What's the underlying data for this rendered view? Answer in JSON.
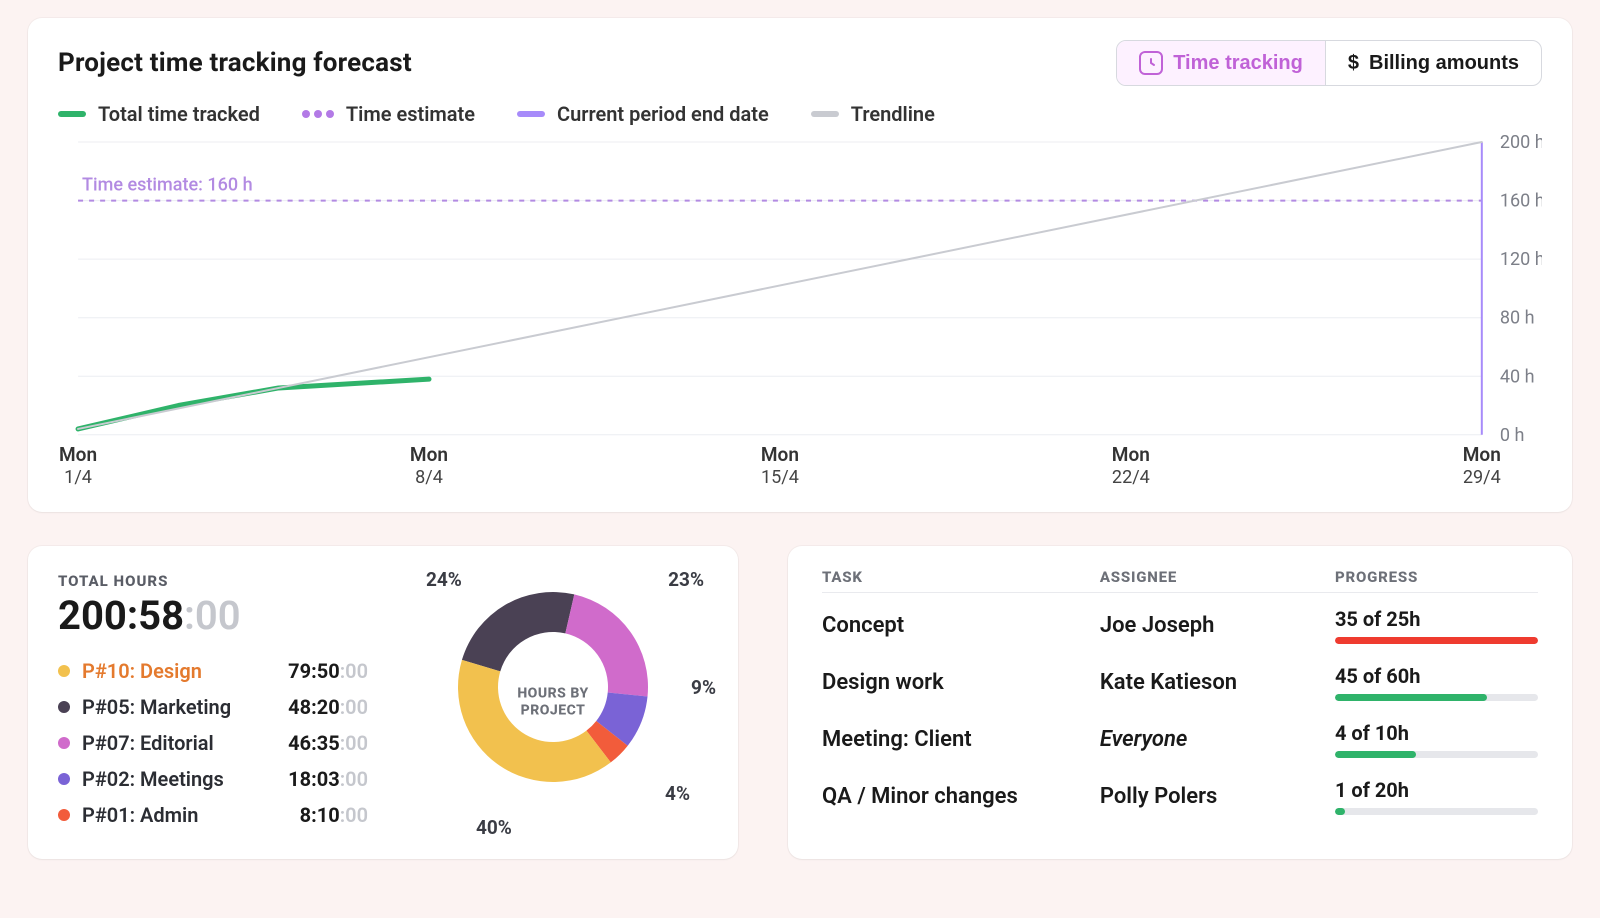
{
  "header": {
    "title": "Project time tracking forecast",
    "toggle": {
      "time_label": "Time tracking",
      "billing_label": "Billing amounts"
    }
  },
  "legend": {
    "total": "Total time tracked",
    "estimate": "Time estimate",
    "period_end": "Current period end date",
    "trendline": "Trendline"
  },
  "chart_data": {
    "type": "line",
    "title": "Project time tracking forecast",
    "xlabel": "",
    "ylabel": "",
    "ylim": [
      0,
      200
    ],
    "y_unit": "h",
    "time_estimate_value": 160,
    "time_estimate_label": "Time estimate: 160 h",
    "current_period_end_x": "29/4",
    "categories_top": [
      "Mon",
      "Mon",
      "Mon",
      "Mon",
      "Mon"
    ],
    "categories": [
      "1/4",
      "8/4",
      "15/4",
      "22/4",
      "29/4"
    ],
    "y_ticks": [
      0,
      40,
      80,
      120,
      160,
      200
    ],
    "series": [
      {
        "name": "Total time tracked",
        "color": "#2fb36a",
        "x": [
          "1/4",
          "3/4",
          "5/4",
          "8/4"
        ],
        "values": [
          4,
          20,
          32,
          38
        ]
      },
      {
        "name": "Trendline",
        "color": "#c9cbd1",
        "x": [
          "1/4",
          "29/4"
        ],
        "values": [
          4,
          200
        ]
      }
    ]
  },
  "total_hours_card": {
    "title": "TOTAL HOURS",
    "total_main": "200:58",
    "total_sec": ":00",
    "donut_center_l1": "HOURS BY",
    "donut_center_l2": "PROJECT",
    "projects": [
      {
        "label": "P#10: Design",
        "color": "#f2c14e",
        "time_main": "79:50",
        "time_sec": ":00",
        "pct": 40,
        "highlight": "#e47a2e"
      },
      {
        "label": "P#05: Marketing",
        "color": "#4a4154",
        "time_main": "48:20",
        "time_sec": ":00",
        "pct": 24
      },
      {
        "label": "P#07: Editorial",
        "color": "#d06bcb",
        "time_main": "46:35",
        "time_sec": ":00",
        "pct": 23
      },
      {
        "label": "P#02: Meetings",
        "color": "#7a63d6",
        "time_main": "18:03",
        "time_sec": ":00",
        "pct": 9
      },
      {
        "label": "P#01: Admin",
        "color": "#f25c3b",
        "time_main": "8:10",
        "time_sec": ":00",
        "pct": 4
      }
    ],
    "donut_labels": {
      "p40": "40%",
      "p24": "24%",
      "p23": "23%",
      "p9": "9%",
      "p4": "4%"
    }
  },
  "tasks_card": {
    "cols": {
      "task": "TASK",
      "assignee": "ASSIGNEE",
      "progress": "PROGRESS"
    },
    "rows": [
      {
        "task": "Concept",
        "assignee": "Joe Joseph",
        "italic": false,
        "prog_text": "35 of 25h",
        "done": 35,
        "total": 25,
        "color": "#ef3b2f"
      },
      {
        "task": "Design work",
        "assignee": "Kate Katieson",
        "italic": false,
        "prog_text": "45 of 60h",
        "done": 45,
        "total": 60,
        "color": "#2fb36a"
      },
      {
        "task": "Meeting: Client",
        "assignee": "Everyone",
        "italic": true,
        "prog_text": "4 of 10h",
        "done": 4,
        "total": 10,
        "color": "#2fb36a"
      },
      {
        "task": "QA / Minor changes",
        "assignee": "Polly Polers",
        "italic": false,
        "prog_text": "1 of 20h",
        "done": 1,
        "total": 20,
        "color": "#2fb36a"
      }
    ]
  },
  "colors": {
    "total_line": "#2fb36a",
    "estimate_dash": "#b28ae2",
    "period_bar": "#a78bfa",
    "trend_line": "#c9cbd1"
  }
}
